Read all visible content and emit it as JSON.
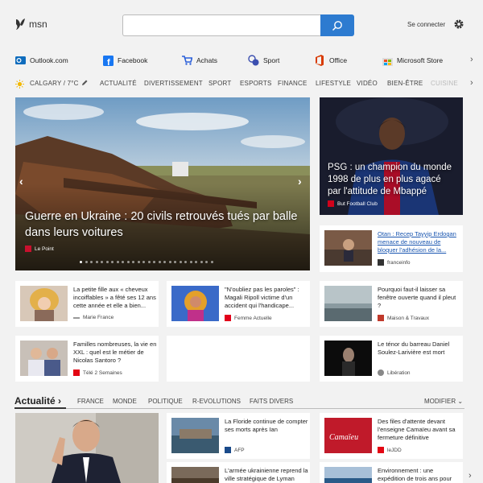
{
  "header": {
    "logo_text": "msn",
    "search_placeholder": "",
    "signin_label": "Se connecter"
  },
  "quicklinks": [
    {
      "label": "Outlook.com",
      "icon": "outlook-icon",
      "color": "#0f6cbd"
    },
    {
      "label": "Facebook",
      "icon": "facebook-icon",
      "color": "#1877f2"
    },
    {
      "label": "Achats",
      "icon": "cart-icon",
      "color": "#2b5fd9"
    },
    {
      "label": "Sport",
      "icon": "sport-icon",
      "color": "#3b4fb0"
    },
    {
      "label": "Office",
      "icon": "office-icon",
      "color": "#d83b01"
    },
    {
      "label": "Microsoft Store",
      "icon": "store-icon",
      "color": "#888888"
    }
  ],
  "nav": {
    "weather": "CALGARY / 7°C",
    "items": [
      "ACTUALITÉ",
      "DIVERTISSEMENT",
      "SPORT",
      "ESPORTS",
      "FINANCE",
      "LIFESTYLE",
      "VIDÉO",
      "BIEN-ÊTRE",
      "CUISINE"
    ]
  },
  "hero": {
    "title": "Guerre en Ukraine : 20 civils retrouvés tués par balle dans leurs voitures",
    "source": "Le Point",
    "source_color": "#c8102e",
    "slide_count": 26,
    "active_slide": 0
  },
  "psg": {
    "title": "PSG : un champion du monde 1998 de plus en plus agacé par l'attitude de Mbappé",
    "source": "But Football Club",
    "source_color": "#d0021b"
  },
  "cards": [
    {
      "text": "Otan : Recep Tayyip Erdogan menace de nouveau de bloquer l'adhésion de la...",
      "source": "franceinfo",
      "source_color": "#333333"
    },
    {
      "text": "La petite fille aux « cheveux incoiffables » a fêté ses 12 ans cette année et elle a bien...",
      "source": "Marie France",
      "source_color": "#999999"
    },
    {
      "text": "\"N'oubliez pas les paroles\" : Magali Ripoll victime d'un accident qui l'handicape...",
      "source": "Femme Actuelle",
      "source_color": "#e2001a"
    },
    {
      "text": "Pourquoi faut-il laisser sa fenêtre ouverte quand il pleut ?",
      "source": "Maison & Travaux",
      "source_color": "#c0392b"
    },
    {
      "text": "Familles nombreuses, la vie en XXL : quel est le métier de Nicolas Santoro ?",
      "source": "Télé 2 Semaines",
      "source_color": "#e30613"
    },
    {
      "text": "Le ténor du barreau Daniel Soulez-Larivière est mort",
      "source": "Libération",
      "source_color": "#888888"
    }
  ],
  "section": {
    "title": "Actualité",
    "tabs": [
      "FRANCE",
      "MONDE",
      "POLITIQUE",
      "R-EVOLUTIONS",
      "FAITS DIVERS"
    ],
    "modify": "MODIFIER"
  },
  "news": [
    {
      "text": "La Floride continue de compter ses morts après Ian",
      "source": "AFP",
      "source_color": "#1a4a8a"
    },
    {
      "text": "Des files d'attente devant l'enseigne Camaïeu avant sa fermeture définitive",
      "source": "leJDD",
      "source_color": "#e30613"
    },
    {
      "text": "L'armée ukrainienne reprend la ville stratégique de Lyman",
      "source": "",
      "source_color": "#333333"
    },
    {
      "text": "Environnement : une expédition de trois ans pour fermer un couvercle...",
      "source": "",
      "source_color": "#333333"
    }
  ]
}
